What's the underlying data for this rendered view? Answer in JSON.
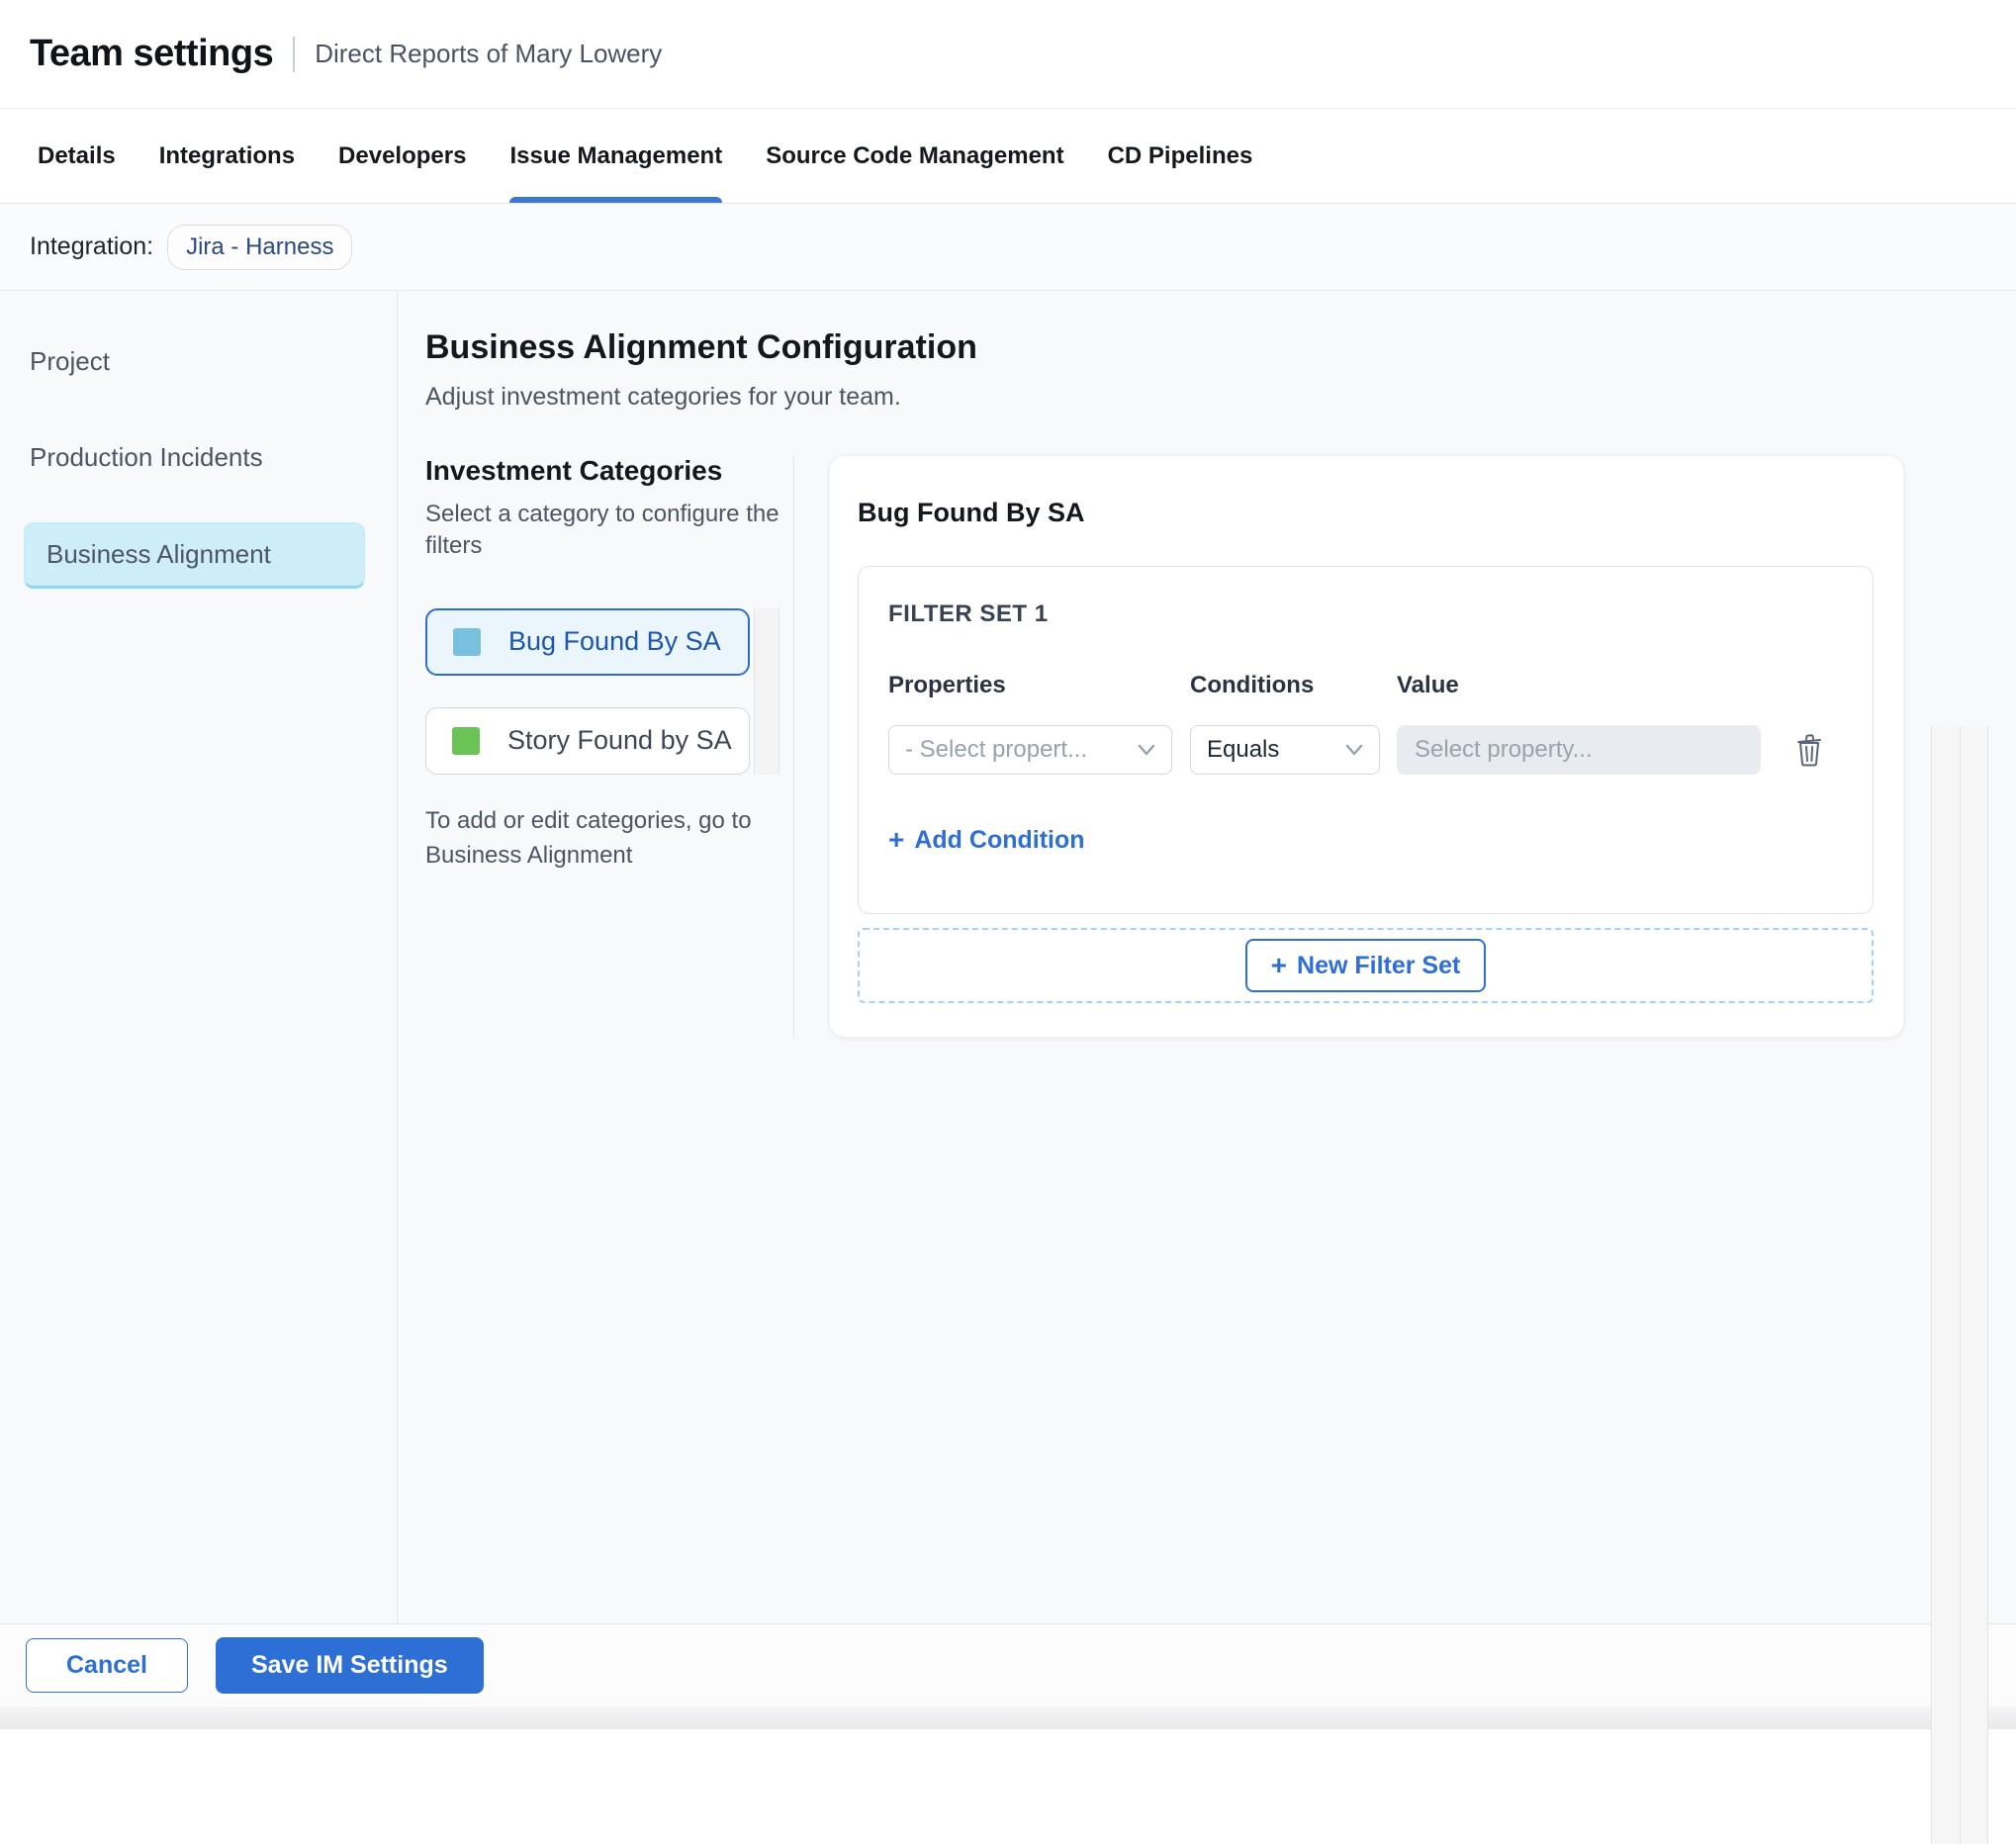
{
  "header": {
    "title": "Team settings",
    "subtitle": "Direct Reports of Mary Lowery"
  },
  "tabs": [
    {
      "label": "Details",
      "active": false
    },
    {
      "label": "Integrations",
      "active": false
    },
    {
      "label": "Developers",
      "active": false
    },
    {
      "label": "Issue Management",
      "active": true
    },
    {
      "label": "Source Code Management",
      "active": false
    },
    {
      "label": "CD Pipelines",
      "active": false
    }
  ],
  "integration": {
    "label": "Integration:",
    "chip": "Jira - Harness"
  },
  "sidebar": {
    "items": [
      {
        "label": "Project",
        "selected": false
      },
      {
        "label": "Production Incidents",
        "selected": false
      },
      {
        "label": "Business Alignment",
        "selected": true
      }
    ]
  },
  "main": {
    "title": "Business Alignment Configuration",
    "subtitle": "Adjust investment categories for your team.",
    "categories": {
      "title": "Investment Categories",
      "hint": "Select a category to configure the filters",
      "items": [
        {
          "label": "Bug Found By SA",
          "swatch_color": "#79c1de",
          "selected": true
        },
        {
          "label": "Story Found by SA",
          "swatch_color": "#6cc355",
          "selected": false
        }
      ],
      "footnote": "To add or edit categories, go to Business Alignment"
    },
    "filter_panel": {
      "title": "Bug Found By SA",
      "filter_set": {
        "title": "FILTER SET 1",
        "columns": {
          "properties": "Properties",
          "conditions": "Conditions",
          "value": "Value"
        },
        "property_placeholder": "- Select propert...",
        "condition_value": "Equals",
        "value_placeholder": "Select property...",
        "add_condition_label": "Add Condition"
      },
      "new_filter_set_label": "New Filter Set"
    }
  },
  "footer": {
    "cancel_label": "Cancel",
    "save_label": "Save IM Settings"
  },
  "icons": {
    "plus": "+"
  },
  "colors": {
    "accent_blue": "#2e6fd6",
    "tab_underline": "#3b76d8",
    "sidebar_selected_bg": "#cdeef9",
    "selected_category_bg": "#eaf6fc",
    "selected_category_text": "#1c55ae",
    "bug_swatch": "#79c1de",
    "story_swatch": "#6cc355",
    "disabled_input_bg": "#e8ebef",
    "dashed_border": "#a7d0f1",
    "content_bg": "#f8f9fb"
  }
}
